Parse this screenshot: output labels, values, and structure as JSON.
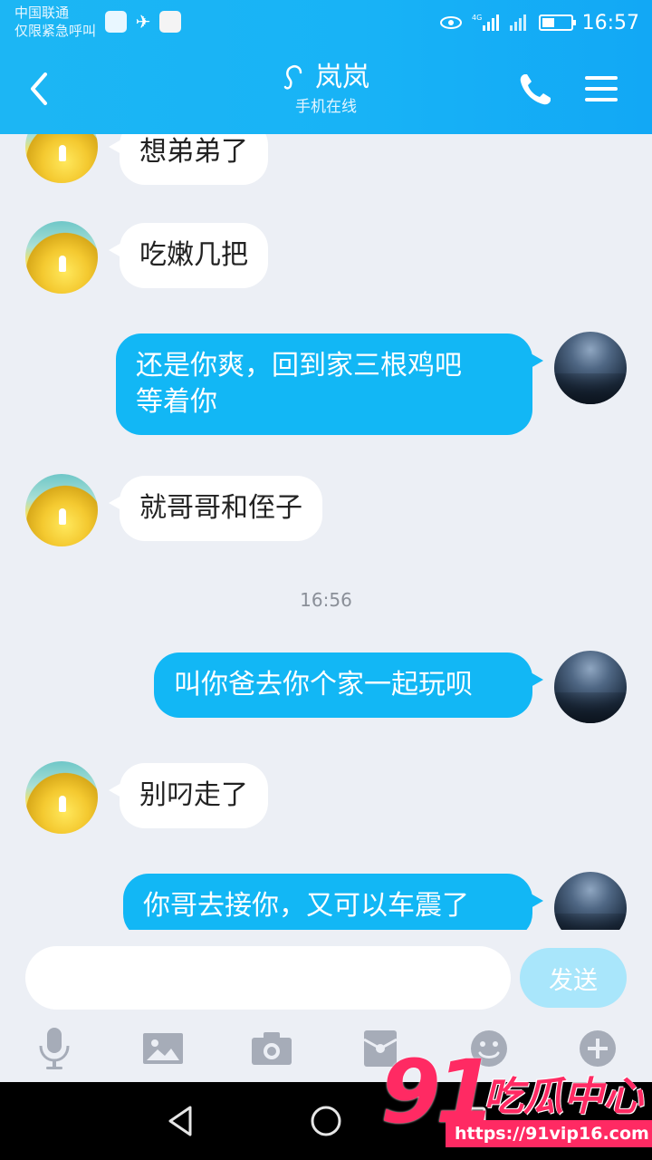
{
  "status_bar": {
    "carrier_line1": "中国联通",
    "carrier_line2": "仅限紧急呼叫",
    "time": "16:57",
    "network": "4G"
  },
  "header": {
    "back_icon": "chevron-left-icon",
    "contact_name": "岚岚",
    "status_text": "手机在线",
    "ear_icon": "ear-icon",
    "call_icon": "phone-icon",
    "menu_icon": "menu-icon"
  },
  "messages": [
    {
      "from": "them",
      "text": "想弟弟了"
    },
    {
      "from": "them",
      "text": "吃嫩几把"
    },
    {
      "from": "me",
      "line1": "还是你爽，回到家三根鸡吧",
      "line2": "等着你"
    },
    {
      "from": "them",
      "text": "就哥哥和侄子"
    },
    {
      "separator": "16:56"
    },
    {
      "from": "me",
      "text": "叫你爸去你个家一起玩呗"
    },
    {
      "from": "them",
      "text": "别叼走了"
    },
    {
      "from": "me",
      "text": "你哥去接你，又可以车震了"
    }
  ],
  "composer": {
    "input_value": "",
    "input_placeholder": "",
    "send_label": "发送"
  },
  "toolbar": [
    "microphone-icon",
    "image-icon",
    "camera-icon",
    "red-packet-icon",
    "emoji-icon",
    "plus-icon"
  ],
  "watermark": {
    "number": "91",
    "text": "吃瓜中心",
    "url": "https://91vip16.com"
  },
  "colors": {
    "header": "#18b3f6",
    "outgoing_bubble": "#12b7f5",
    "incoming_bubble": "#ffffff",
    "background": "#eceff5",
    "watermark": "#ff2a63"
  }
}
